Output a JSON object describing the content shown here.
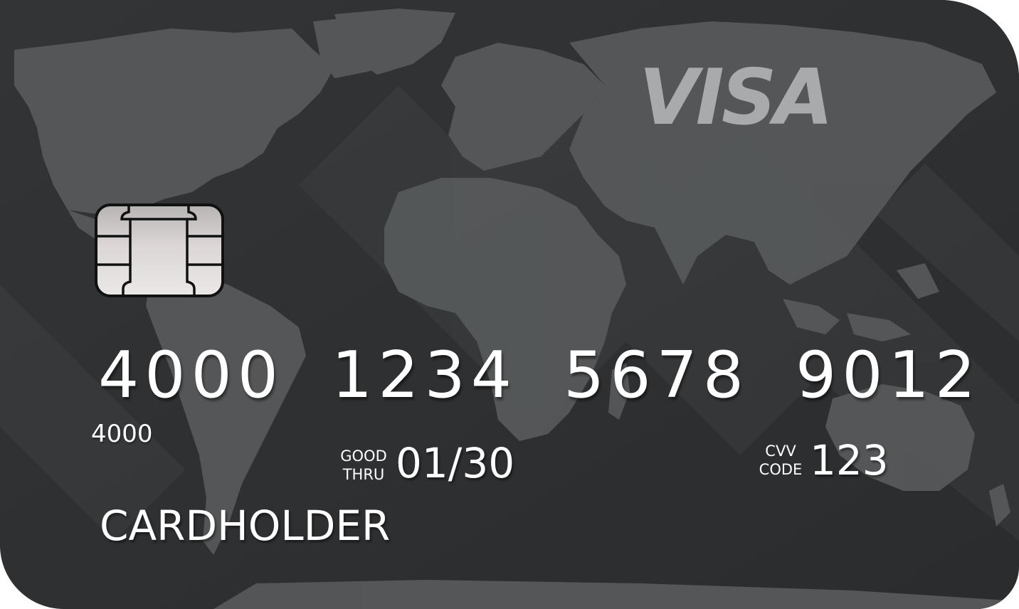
{
  "card": {
    "brand": "VISA",
    "number_groups": [
      "4000",
      "1234",
      "5678",
      "9012"
    ],
    "number_prefix_small": "4000",
    "expiry_label_line1": "GOOD",
    "expiry_label_line2": "THRU",
    "expiry": "01/30",
    "cvv_label_line1": "CVV",
    "cvv_label_line2": "CODE",
    "cvv": "123",
    "holder": "CARDHOLDER"
  },
  "colors": {
    "card_background": "#2e3032",
    "map_land": "#56585a",
    "logo": "#a9aaab",
    "chip": "#dcd6d6",
    "text": "#ffffff"
  },
  "icons": {
    "chip": "emv-chip-icon",
    "map": "world-map-graphic"
  }
}
